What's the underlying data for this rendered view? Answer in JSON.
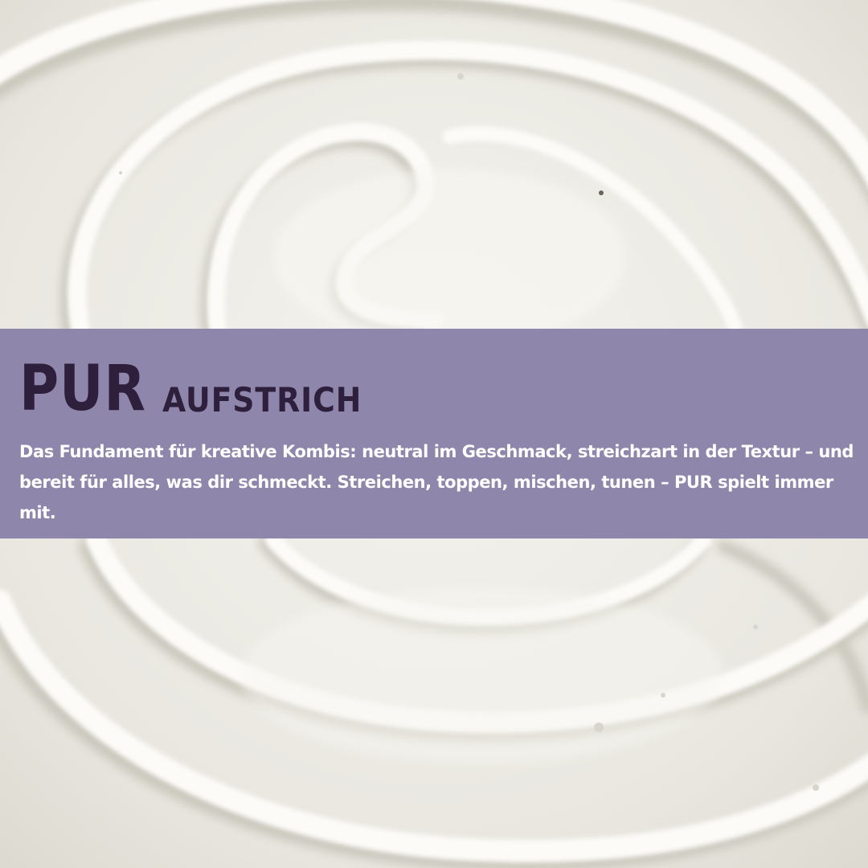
{
  "image": {
    "subject": "swirled-cream-spread-photo",
    "colors": {
      "cream_base": "#eeece6",
      "cream_highlight": "#fbfaf6",
      "cream_shadow": "#c9c6bc",
      "band": "#8f86ab",
      "headline": "#2e1f3d",
      "body_text": "#ffffff"
    }
  },
  "banner": {
    "headline_main": "PUR",
    "headline_sub": "AUFSTRICH",
    "description": "Das Fundament für kreative Kombis: neutral im Geschmack, streichzart in der Textur – und bereit für alles, was dir schmeckt. Streichen, toppen, mischen, tunen – PUR spielt immer mit."
  }
}
